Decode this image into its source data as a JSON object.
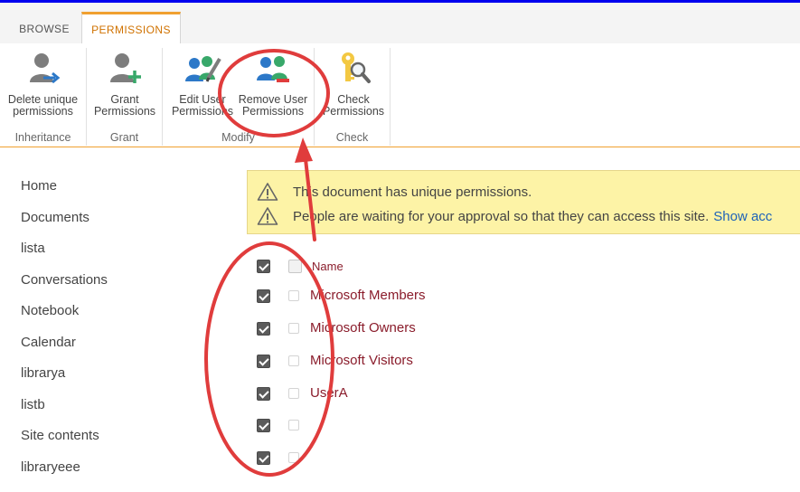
{
  "tabs": [
    {
      "label": "BROWSE"
    },
    {
      "label": "PERMISSIONS"
    }
  ],
  "ribbon": {
    "groups": [
      {
        "label": "Inheritance",
        "buttons": [
          {
            "line1": "Delete unique",
            "line2": "permissions"
          }
        ]
      },
      {
        "label": "Grant",
        "buttons": [
          {
            "line1": "Grant",
            "line2": "Permissions"
          }
        ]
      },
      {
        "label": "Modify",
        "buttons": [
          {
            "line1": "Edit User",
            "line2": "Permissions"
          },
          {
            "line1": "Remove User",
            "line2": "Permissions"
          }
        ]
      },
      {
        "label": "Check",
        "buttons": [
          {
            "line1": "Check",
            "line2": "Permissions"
          }
        ]
      }
    ]
  },
  "nav": {
    "items": [
      "Home",
      "Documents",
      "lista",
      "Conversations",
      "Notebook",
      "Calendar",
      "librarya",
      "listb",
      "Site contents",
      "libraryeee"
    ]
  },
  "banner": {
    "line1": "This document has unique permissions.",
    "line2": "People are waiting for your approval so that they can access this site.",
    "link": "Show acc"
  },
  "list": {
    "header": "Name",
    "rows": [
      "Microsoft Members",
      "Microsoft Owners",
      "Microsoft Visitors",
      "UserA",
      "",
      ""
    ]
  },
  "colors": {
    "accent": "#f0a030",
    "link": "#8a1c2b",
    "annotation": "#e03c3c",
    "banner_bg": "#fdf3a6"
  }
}
